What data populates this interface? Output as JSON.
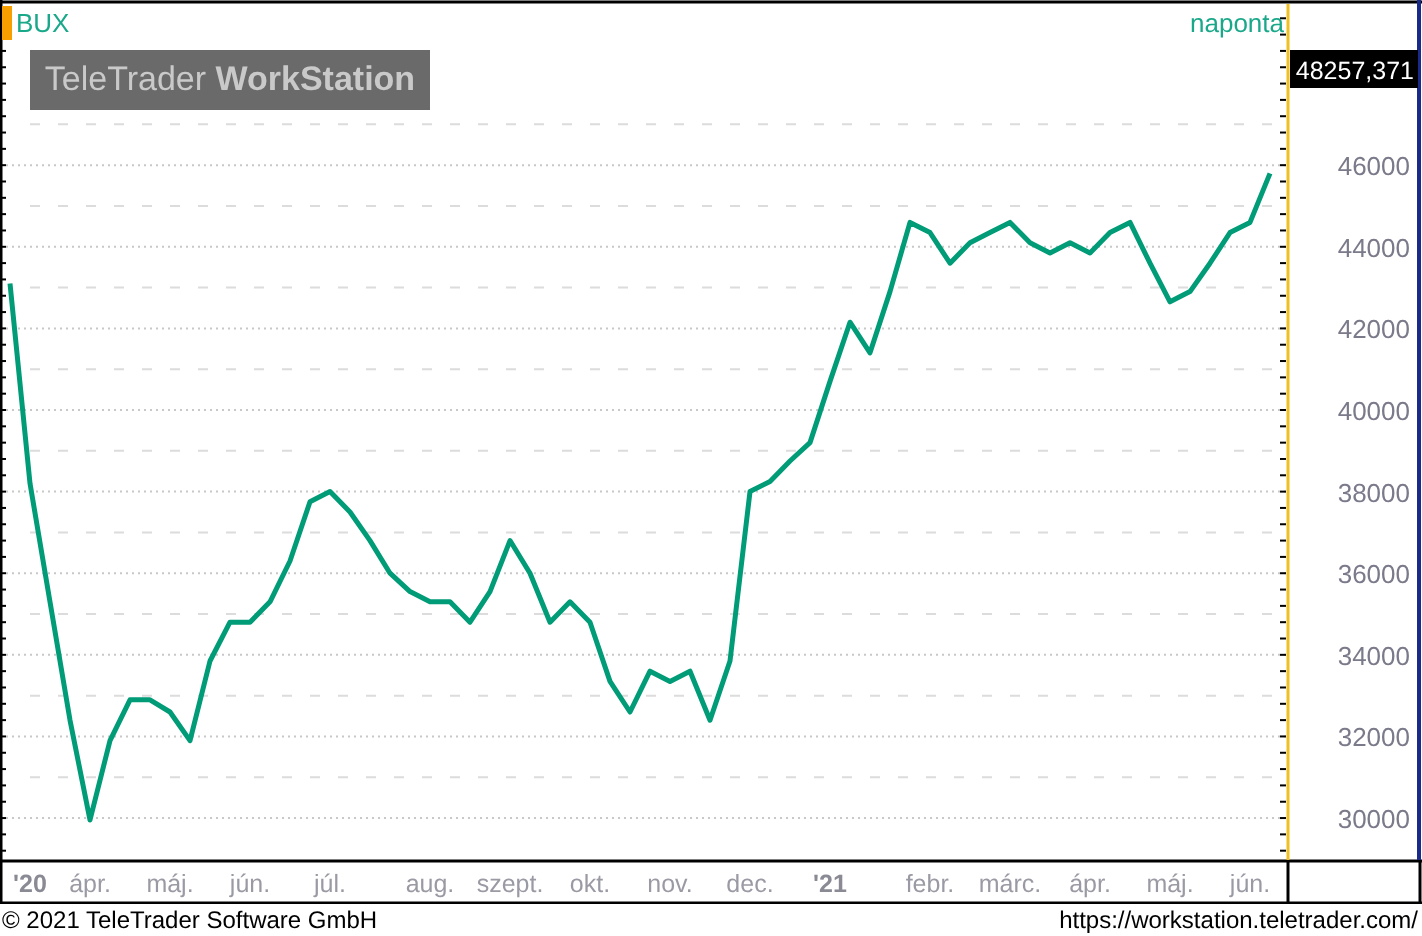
{
  "chart": {
    "interval": "naponta",
    "logo": "TeleTrader **WorkStation**",
    "last_value_label": "48257,371",
    "chart_data": {
      "type": "line",
      "title": "BUX",
      "ylim": [
        29070,
        49950
      ],
      "grid": true,
      "categories": [
        null,
        "'20",
        null,
        null,
        "ápr.",
        null,
        null,
        null,
        "máj.",
        null,
        null,
        null,
        "jún.",
        null,
        null,
        null,
        "júl.",
        null,
        null,
        null,
        null,
        "aug.",
        null,
        null,
        null,
        "szept.",
        null,
        null,
        null,
        "okt.",
        null,
        null,
        null,
        "nov.",
        null,
        null,
        null,
        "dec.",
        null,
        null,
        null,
        "'21",
        null,
        null,
        null,
        null,
        "febr.",
        null,
        null,
        null,
        "márc.",
        null,
        null,
        null,
        "ápr.",
        null,
        null,
        null,
        "máj.",
        null,
        null,
        null,
        "jún.",
        null
      ],
      "series": [
        {
          "color": "#009b77",
          "values": [
            43100,
            38200,
            35300,
            32400,
            29950,
            31900,
            32900,
            32900,
            32600,
            31900,
            33850,
            34800,
            34800,
            35300,
            36300,
            37750,
            38000,
            37500,
            36800,
            36000,
            35550,
            35300,
            35300,
            34800,
            35550,
            36800,
            36000,
            34800,
            35300,
            34800,
            33350,
            32600,
            33600,
            33350,
            33600,
            32400,
            33850,
            38000,
            38250,
            38750,
            39200,
            40700,
            42150,
            41400,
            42900,
            44600,
            44350,
            43600,
            44100,
            44350,
            44600,
            44100,
            43850,
            44100,
            43850,
            44350,
            44600,
            43600,
            42650,
            42900,
            43600,
            44350,
            44600,
            45800
          ]
        }
      ],
      "yticks": [
        30000,
        32000,
        34000,
        36000,
        38000,
        40000,
        42000,
        44000,
        46000
      ]
    }
  },
  "footer": {
    "copyright": "© 2021 TeleTrader Software GmbH",
    "url": "https://workstation.teletrader.com/"
  }
}
